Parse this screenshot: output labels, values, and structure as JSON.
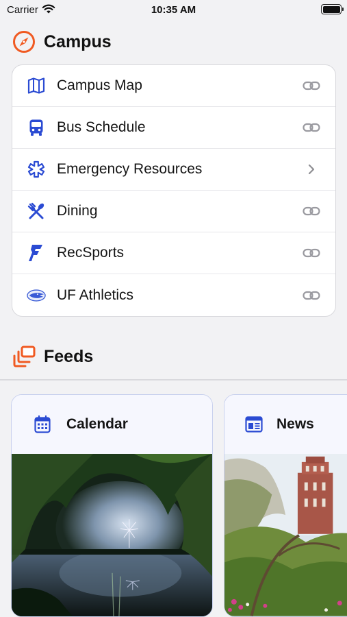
{
  "status_bar": {
    "carrier": "Carrier",
    "time": "10:35 AM"
  },
  "campus": {
    "title": "Campus",
    "items": [
      {
        "label": "Campus Map",
        "icon": "map-icon",
        "trail": "link-icon"
      },
      {
        "label": "Bus Schedule",
        "icon": "bus-icon",
        "trail": "link-icon"
      },
      {
        "label": "Emergency Resources",
        "icon": "medical-star-icon",
        "trail": "chevron-right-icon"
      },
      {
        "label": "Dining",
        "icon": "utensils-icon",
        "trail": "link-icon"
      },
      {
        "label": "RecSports",
        "icon": "recsports-logo-icon",
        "trail": "link-icon"
      },
      {
        "label": "UF Athletics",
        "icon": "gator-logo-icon",
        "trail": "link-icon"
      }
    ]
  },
  "feeds": {
    "title": "Feeds",
    "cards": [
      {
        "label": "Calendar",
        "icon": "calendar-icon"
      },
      {
        "label": "News",
        "icon": "newspaper-icon"
      }
    ]
  },
  "colors": {
    "accent_orange": "#f05a22",
    "icon_blue": "#2b4bd3",
    "link_gray": "#9a9aa0"
  }
}
